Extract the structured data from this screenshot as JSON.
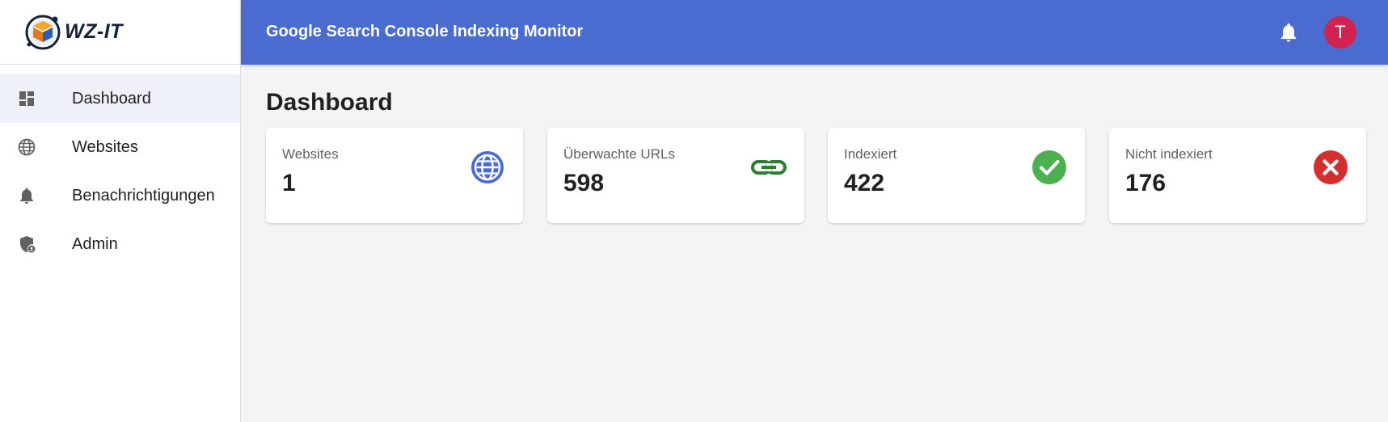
{
  "brand": {
    "name": "WZ-IT"
  },
  "header": {
    "title": "Google Search Console Indexing Monitor",
    "avatar_initial": "T"
  },
  "sidebar": {
    "items": [
      {
        "label": "Dashboard",
        "icon": "dashboard-icon",
        "active": true
      },
      {
        "label": "Websites",
        "icon": "globe-icon",
        "active": false
      },
      {
        "label": "Benachrichtigungen",
        "icon": "bell-icon",
        "active": false
      },
      {
        "label": "Admin",
        "icon": "admin-shield-icon",
        "active": false
      }
    ]
  },
  "main": {
    "title": "Dashboard",
    "cards": [
      {
        "label": "Websites",
        "value": "1",
        "icon": "globe-icon",
        "color": "#4a6bd0"
      },
      {
        "label": "Überwachte URLs",
        "value": "598",
        "icon": "link-icon",
        "color": "#2e7d32"
      },
      {
        "label": "Indexiert",
        "value": "422",
        "icon": "check-circle-icon",
        "color": "#4caf50"
      },
      {
        "label": "Nicht indexiert",
        "value": "176",
        "icon": "cancel-circle-icon",
        "color": "#d32f2f"
      }
    ]
  },
  "colors": {
    "topbar": "#4a6bd0",
    "avatar": "#d0234f",
    "active_nav": "#eef1fa"
  }
}
